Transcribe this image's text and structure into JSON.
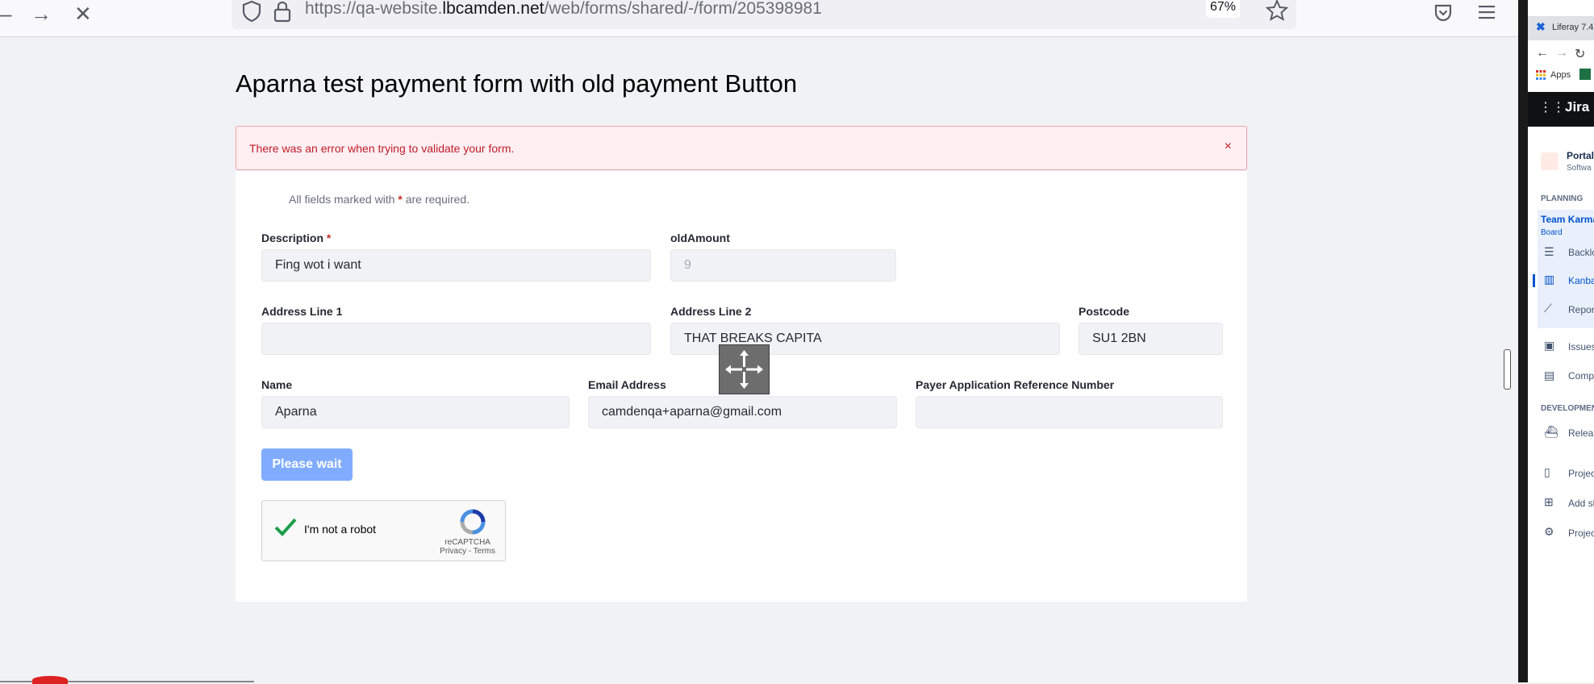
{
  "browser": {
    "url_prefix": "https://qa-website.",
    "url_domain": "lbcamden.net",
    "url_path": "/web/forms/shared/-/form/205398981",
    "zoom": "67%"
  },
  "form": {
    "title": "Aparna test payment form with old payment Button",
    "error_message": "There was an error when trying to validate your form.",
    "close_glyph": "×",
    "required_note_prefix": "All fields marked with ",
    "required_star": "*",
    "required_note_suffix": " are required.",
    "fields": {
      "description": {
        "label": "Description",
        "value": "Fing wot i want"
      },
      "old_amount": {
        "label": "oldAmount",
        "value": "9"
      },
      "address1": {
        "label": "Address Line 1",
        "value": ""
      },
      "address2": {
        "label": "Address Line 2",
        "value": "THAT BREAKS CAPITA"
      },
      "postcode": {
        "label": "Postcode",
        "value": "SU1 2BN"
      },
      "name": {
        "label": "Name",
        "value": "Aparna"
      },
      "email": {
        "label": "Email Address",
        "value": "camdenqa+aparna@gmail.com"
      },
      "payer_ref": {
        "label": "Payer Application Reference Number",
        "value": ""
      }
    },
    "submit_label": "Please wait",
    "captcha": {
      "label": "I'm not a robot",
      "brand": "reCAPTCHA",
      "links": "Privacy - Terms"
    }
  },
  "side_window": {
    "tab_title": "Liferay 7.4",
    "apps_label": "Apps",
    "jira_label": "Jira",
    "project_title": "Portal",
    "project_subtitle": "Softwa",
    "planning_heading": "PLANNING",
    "board_name": "Team Karma",
    "board_type": "Board",
    "nav_backlog": "Backlo",
    "nav_kanban": "Kanba",
    "nav_reports": "Repor",
    "nav_issues": "Issues",
    "nav_components": "Comp",
    "development_heading": "DEVELOPMENT",
    "nav_releases": "Releas",
    "nav_project_pages": "Projec",
    "nav_add_shortcut": "Add sh",
    "nav_project_settings": "Projec"
  },
  "colors": {
    "accent": "#0b5fff",
    "button_disabled": "#80acff",
    "error": "#c01b28",
    "error_bg": "#feeff2",
    "captcha_check": "#1e9e4a"
  }
}
